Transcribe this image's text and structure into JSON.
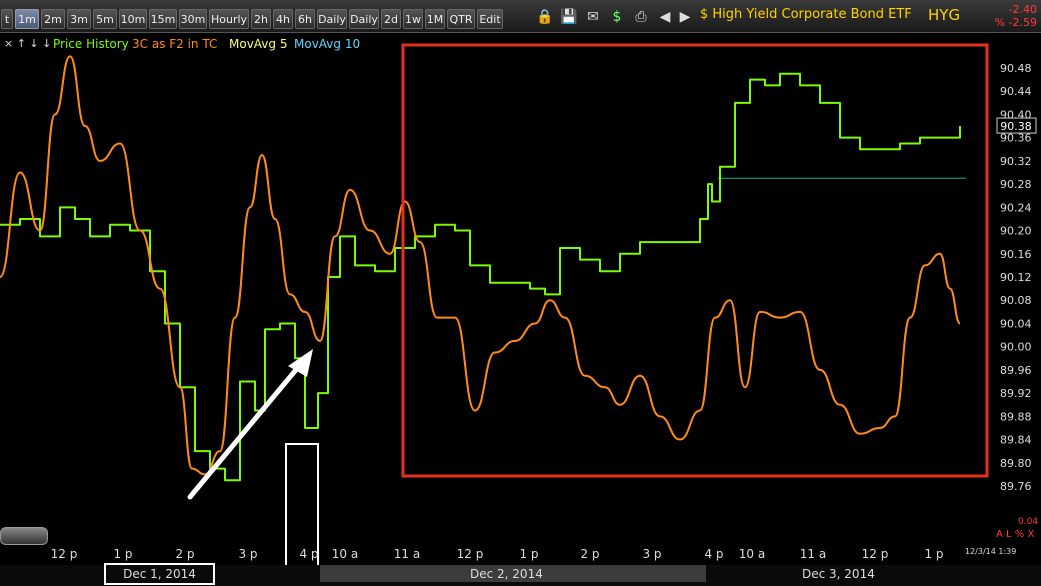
{
  "toolbar": {
    "buttons": [
      "t",
      "1m",
      "2m",
      "3m",
      "5m",
      "10m",
      "15m",
      "30m",
      "Hourly",
      "2h",
      "4h",
      "6h",
      "Daily",
      "Daily",
      "2d",
      "1w",
      "1M",
      "QTR",
      "Edit"
    ],
    "active_index": 1,
    "icons": [
      "lock-icon",
      "save-icon",
      "mail-icon",
      "dollar-icon",
      "print-icon",
      "scroll-left-icon",
      "scroll-right-icon"
    ],
    "ticker_title": "$ High Yield Corporate Bond ETF",
    "symbol": "HYG",
    "change_abs": "-2.40",
    "change_pct": "% -2.59"
  },
  "legend": {
    "arrows": "× ↑ ↓ ↓",
    "items": [
      "Price History",
      "3C as F2 in TC",
      "MovAvg 5",
      "MovAvg 10"
    ],
    "colors": [
      "#7cfc00",
      "#ff8c1a",
      "#ffff66",
      "#5fd6ff"
    ]
  },
  "footer": {
    "dates": [
      "Dec 1, 2014",
      "Dec 2, 2014",
      "Dec 3, 2014"
    ],
    "timestamp": "12/3/14 1:39",
    "zero_label": "0.04",
    "alx_label": "A L % X"
  },
  "chart_data": {
    "type": "line",
    "x_ticks": [
      "12 p",
      "1 p",
      "2 p",
      "3 p",
      "4 p",
      "10 a",
      "11 a",
      "12 p",
      "1 p",
      "2 p",
      "3 p",
      "4 p",
      "10 a",
      "11 a",
      "12 p",
      "1 p"
    ],
    "y_ticks": [
      90.48,
      90.44,
      90.4,
      90.36,
      90.32,
      90.28,
      90.24,
      90.2,
      90.16,
      90.12,
      90.08,
      90.04,
      90.0,
      89.96,
      89.92,
      89.88,
      89.84,
      89.8,
      89.76
    ],
    "ylim": [
      89.74,
      90.5
    ],
    "last_price": "90.38",
    "reference_level": 90.29,
    "series": [
      {
        "name": "Price History",
        "color": "#7cfc00",
        "x": [
          0,
          20,
          40,
          60,
          75,
          90,
          110,
          130,
          150,
          165,
          180,
          195,
          210,
          225,
          240,
          255,
          265,
          280,
          295,
          305,
          318,
          328,
          340,
          355,
          375,
          395,
          415,
          435,
          455,
          470,
          490,
          510,
          530,
          545,
          560,
          580,
          600,
          620,
          640,
          660,
          680,
          700,
          708,
          712,
          720,
          735,
          750,
          765,
          780,
          800,
          820,
          840,
          860,
          880,
          900,
          920,
          940,
          960
        ],
        "y": [
          90.21,
          90.22,
          90.19,
          90.24,
          90.22,
          90.19,
          90.21,
          90.2,
          90.13,
          90.04,
          89.93,
          89.82,
          89.79,
          89.77,
          89.94,
          89.89,
          90.03,
          90.04,
          89.98,
          89.86,
          89.92,
          90.12,
          90.19,
          90.14,
          90.13,
          90.17,
          90.19,
          90.21,
          90.2,
          90.14,
          90.11,
          90.11,
          90.1,
          90.09,
          90.17,
          90.15,
          90.13,
          90.16,
          90.18,
          90.18,
          90.18,
          90.22,
          90.28,
          90.25,
          90.31,
          90.42,
          90.46,
          90.45,
          90.47,
          90.45,
          90.42,
          90.36,
          90.34,
          90.34,
          90.35,
          90.36,
          90.36,
          90.38
        ]
      },
      {
        "name": "3C as F2 in TC",
        "color": "#ff8c1a",
        "x": [
          0,
          20,
          40,
          55,
          70,
          85,
          100,
          120,
          140,
          160,
          180,
          192,
          205,
          220,
          235,
          250,
          262,
          275,
          290,
          305,
          320,
          335,
          350,
          370,
          390,
          405,
          420,
          437,
          455,
          475,
          495,
          515,
          535,
          550,
          565,
          585,
          605,
          620,
          640,
          660,
          680,
          700,
          715,
          730,
          745,
          760,
          780,
          800,
          820,
          840,
          860,
          880,
          895,
          910,
          925,
          940,
          950,
          960
        ],
        "y": [
          90.12,
          90.3,
          90.2,
          90.4,
          90.5,
          90.38,
          90.32,
          90.35,
          90.2,
          90.1,
          89.93,
          89.79,
          89.78,
          89.82,
          90.05,
          90.24,
          90.33,
          90.22,
          90.09,
          90.06,
          90.01,
          90.19,
          90.27,
          90.2,
          90.16,
          90.25,
          90.18,
          90.05,
          90.05,
          89.89,
          89.99,
          90.01,
          90.04,
          90.08,
          90.05,
          89.95,
          89.93,
          89.9,
          89.95,
          89.88,
          89.84,
          89.89,
          90.05,
          90.08,
          89.93,
          90.06,
          90.05,
          90.06,
          89.96,
          89.9,
          89.85,
          89.86,
          89.88,
          90.05,
          90.14,
          90.16,
          90.1,
          90.04
        ]
      }
    ]
  }
}
